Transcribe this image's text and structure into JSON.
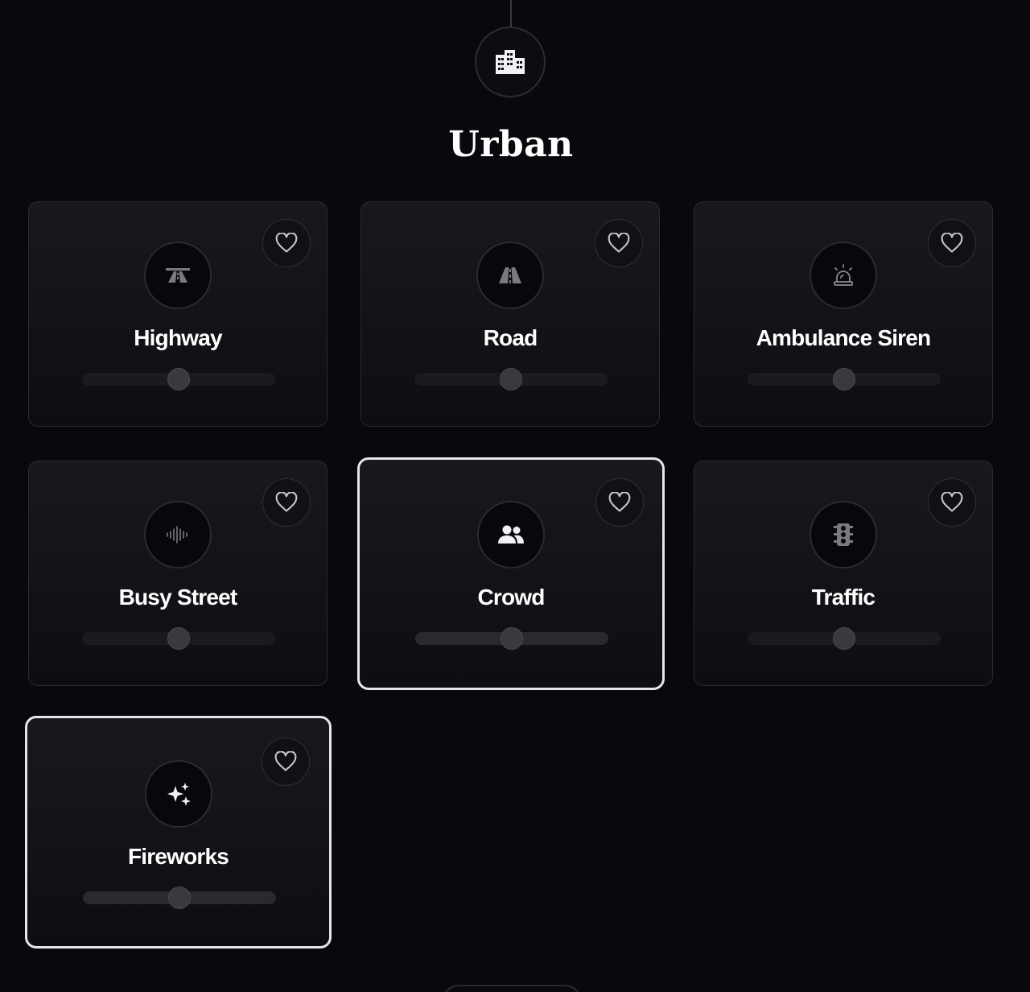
{
  "category": {
    "title": "Urban",
    "icon": "city-icon"
  },
  "sounds": [
    {
      "name": "Highway",
      "icon": "highway-icon",
      "volume": 0.5,
      "active": false
    },
    {
      "name": "Road",
      "icon": "road-icon",
      "volume": 0.5,
      "active": false
    },
    {
      "name": "Ambulance Siren",
      "icon": "siren-icon",
      "volume": 0.5,
      "active": false
    },
    {
      "name": "Busy Street",
      "icon": "soundwave-icon",
      "volume": 0.5,
      "active": false
    },
    {
      "name": "Crowd",
      "icon": "people-icon",
      "volume": 0.5,
      "active": true
    },
    {
      "name": "Traffic",
      "icon": "traffic-light-icon",
      "volume": 0.5,
      "active": false
    },
    {
      "name": "Fireworks",
      "icon": "sparkles-icon",
      "volume": 0.5,
      "active": true
    }
  ],
  "colors": {
    "background": "#09080c",
    "active_border": "#e6e6ea"
  }
}
